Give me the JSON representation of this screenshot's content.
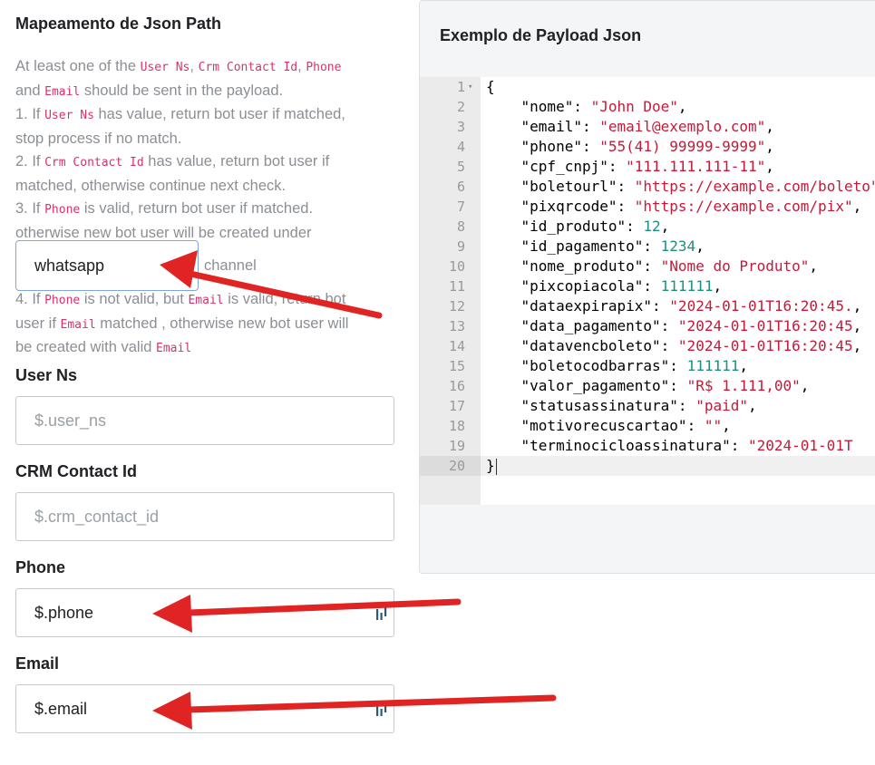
{
  "section": {
    "title": "Mapeamento de Json Path"
  },
  "help": {
    "p1_prefix": "At least one of the ",
    "p1_code1": "User Ns",
    "p1_sep1": ", ",
    "p1_code2": "Crm Contact Id",
    "p1_sep2": ", ",
    "p1_code3": "Phone",
    "p2_prefix": "and ",
    "p2_code": "Email",
    "p2_suffix": " should be sent in the payload.",
    "p3_prefix": "1. If ",
    "p3_code": "User Ns",
    "p3_suffix": " has value, return bot user if matched,",
    "p4": "stop process if no match.",
    "p5_prefix": "2. If ",
    "p5_code": "Crm Contact Id",
    "p5_suffix": " has value, return bot user if",
    "p6": "matched, otherwise continue next check.",
    "p7_prefix": "3. If ",
    "p7_code": "Phone",
    "p7_suffix": " is valid, return bot user if matched.",
    "p8": "otherwise new bot user will be created under",
    "p9_prefix": "4. If ",
    "p9_code1": "Phone",
    "p9_mid": " is not valid, but ",
    "p9_code2": "Email",
    "p9_suffix": " is valid, return bot",
    "p10_prefix": "user if ",
    "p10_code": "Email",
    "p10_suffix": " matched , otherwise new bot user will",
    "p11_prefix": "be created with valid ",
    "p11_code": "Email"
  },
  "channel": {
    "selected": "whatsapp",
    "suffix": "channel"
  },
  "fields": {
    "user_ns": {
      "label": "User Ns",
      "placeholder": "$.user_ns",
      "value": ""
    },
    "crm_contact_id": {
      "label": "CRM Contact Id",
      "placeholder": "$.crm_contact_id",
      "value": ""
    },
    "phone": {
      "label": "Phone",
      "placeholder": "",
      "value": "$.phone"
    },
    "email": {
      "label": "Email",
      "placeholder": "",
      "value": "$.email"
    }
  },
  "payload": {
    "title": "Exemplo de Payload Json",
    "lines": [
      {
        "num": "1",
        "fold": true,
        "key": "",
        "val": "",
        "type": "open"
      },
      {
        "num": "2",
        "key": "\"nome\"",
        "val": "\"John Doe\"",
        "type": "s"
      },
      {
        "num": "3",
        "key": "\"email\"",
        "val": "\"email@exemplo.com\"",
        "type": "s"
      },
      {
        "num": "4",
        "key": "\"phone\"",
        "val": "\"55(41) 99999-9999\"",
        "type": "s"
      },
      {
        "num": "5",
        "key": "\"cpf_cnpj\"",
        "val": "\"111.111.111-11\"",
        "type": "s"
      },
      {
        "num": "6",
        "key": "\"boletourl\"",
        "val": "\"https://example.com/boleto\"",
        "type": "s"
      },
      {
        "num": "7",
        "key": "\"pixqrcode\"",
        "val": "\"https://example.com/pix\"",
        "type": "s"
      },
      {
        "num": "8",
        "key": "\"id_produto\"",
        "val": "12",
        "type": "n"
      },
      {
        "num": "9",
        "key": "\"id_pagamento\"",
        "val": "1234",
        "type": "n"
      },
      {
        "num": "10",
        "key": "\"nome_produto\"",
        "val": "\"Nome do Produto\"",
        "type": "s"
      },
      {
        "num": "11",
        "key": "\"pixcopiacola\"",
        "val": "111111",
        "type": "n"
      },
      {
        "num": "12",
        "key": "\"dataexpirapix\"",
        "val": "\"2024-01-01T16:20:45.",
        "type": "s"
      },
      {
        "num": "13",
        "key": "\"data_pagamento\"",
        "val": "\"2024-01-01T16:20:45",
        "type": "s"
      },
      {
        "num": "14",
        "key": "\"datavencboleto\"",
        "val": "\"2024-01-01T16:20:45",
        "type": "s"
      },
      {
        "num": "15",
        "key": "\"boletocodbarras\"",
        "val": "111111",
        "type": "n"
      },
      {
        "num": "16",
        "key": "\"valor_pagamento\"",
        "val": "\"R$ 1.111,00\"",
        "type": "s"
      },
      {
        "num": "17",
        "key": "\"statusassinatura\"",
        "val": "\"paid\"",
        "type": "s"
      },
      {
        "num": "18",
        "key": "\"motivorecuscartao\"",
        "val": "\"\"",
        "type": "s"
      },
      {
        "num": "19",
        "key": "\"terminocicloassinatura\"",
        "val": "\"2024-01-01T",
        "type": "s",
        "last": true
      },
      {
        "num": "20",
        "key": "",
        "val": "",
        "type": "close",
        "active": true
      }
    ]
  },
  "colors": {
    "code_token": "#d6336c",
    "arrow": "#e02424",
    "select_border": "#7fa6e0"
  },
  "icons": [
    "chevron-down-icon",
    "field-extension-icon",
    "annotation-arrow"
  ]
}
